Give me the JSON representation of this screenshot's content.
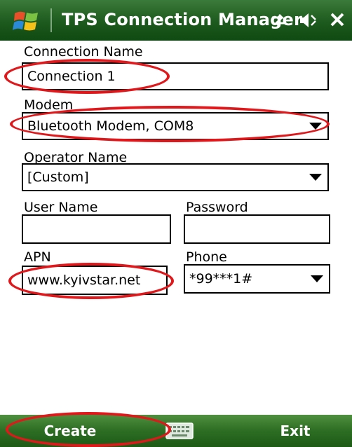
{
  "window": {
    "title": "TPS Connection Manager",
    "icons": {
      "start": "windows-flag-icon",
      "connectivity": "connectivity-icon",
      "volume": "volume-icon",
      "close": "close-icon"
    }
  },
  "form": {
    "connection_name": {
      "label": "Connection Name",
      "value": "Connection 1"
    },
    "modem": {
      "label": "Modem",
      "value": "Bluetooth Modem, COM8"
    },
    "operator_name": {
      "label": "Operator Name",
      "value": "[Custom]"
    },
    "user_name": {
      "label": "User Name",
      "value": ""
    },
    "password": {
      "label": "Password",
      "value": ""
    },
    "apn": {
      "label": "APN",
      "value": "www.kyivstar.net"
    },
    "phone": {
      "label": "Phone",
      "value": "*99***1#"
    }
  },
  "softkeys": {
    "left": "Create",
    "right": "Exit",
    "center_icon": "keyboard-icon"
  },
  "colors": {
    "titlebar": "#1d5a1d",
    "softbar": "#2c6d23",
    "highlight": "#e0181b"
  }
}
